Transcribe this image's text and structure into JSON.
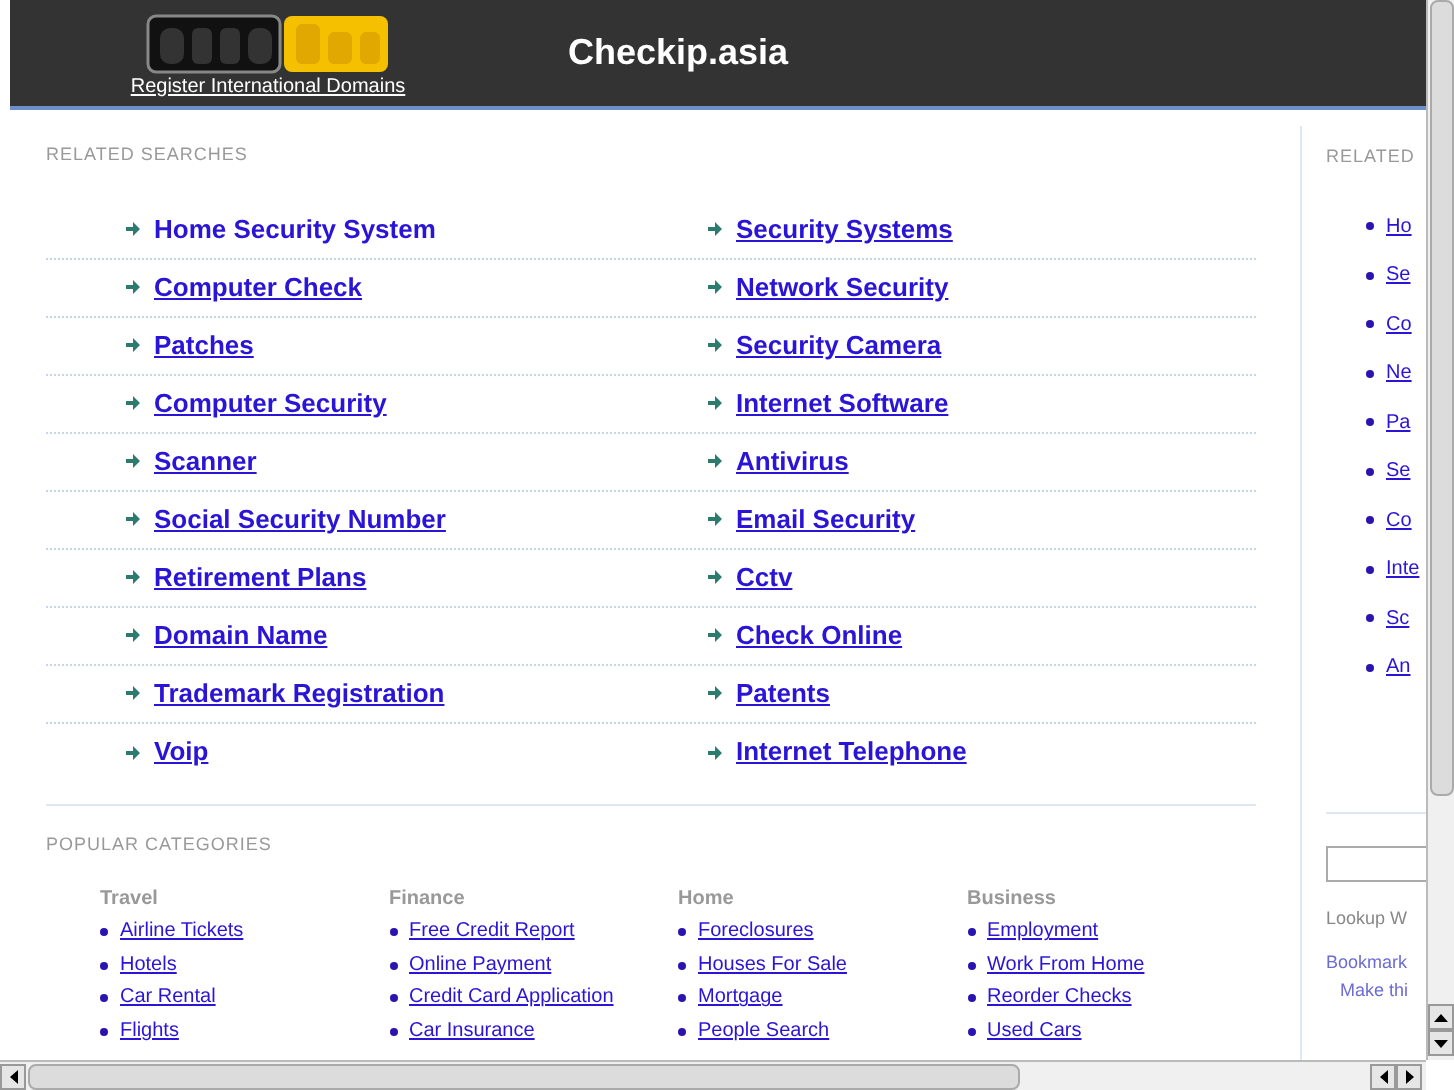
{
  "header": {
    "logo_tagline": "Register International Domains",
    "site_title": "Checkip.asia"
  },
  "related_searches": {
    "title": "RELATED SEARCHES",
    "left": [
      {
        "label": "Home Security System",
        "underlined": false
      },
      {
        "label": "Computer Check",
        "underlined": true
      },
      {
        "label": "Patches",
        "underlined": true
      },
      {
        "label": "Computer Security",
        "underlined": true
      },
      {
        "label": "Scanner",
        "underlined": true
      },
      {
        "label": "Social Security Number",
        "underlined": true
      },
      {
        "label": "Retirement Plans",
        "underlined": true
      },
      {
        "label": "Domain Name",
        "underlined": true
      },
      {
        "label": "Trademark Registration",
        "underlined": true
      },
      {
        "label": "Voip",
        "underlined": true
      }
    ],
    "right": [
      {
        "label": "Security Systems",
        "underlined": true
      },
      {
        "label": "Network Security",
        "underlined": true
      },
      {
        "label": "Security Camera",
        "underlined": true
      },
      {
        "label": "Internet Software",
        "underlined": true
      },
      {
        "label": "Antivirus",
        "underlined": true
      },
      {
        "label": "Email Security",
        "underlined": true
      },
      {
        "label": "Cctv",
        "underlined": true
      },
      {
        "label": "Check Online",
        "underlined": true
      },
      {
        "label": "Patents",
        "underlined": true
      },
      {
        "label": "Internet Telephone",
        "underlined": true
      }
    ]
  },
  "popular_categories": {
    "title": "POPULAR CATEGORIES",
    "columns": [
      {
        "heading": "Travel",
        "links": [
          "Airline Tickets",
          "Hotels",
          "Car Rental",
          "Flights"
        ]
      },
      {
        "heading": "Finance",
        "links": [
          "Free Credit Report",
          "Online Payment",
          "Credit Card Application",
          "Car Insurance"
        ]
      },
      {
        "heading": "Home",
        "links": [
          "Foreclosures",
          "Houses For Sale",
          "Mortgage",
          "People Search"
        ]
      },
      {
        "heading": "Business",
        "links": [
          "Employment",
          "Work From Home",
          "Reorder Checks",
          "Used Cars"
        ]
      }
    ]
  },
  "sidebar": {
    "title": "RELATED",
    "links": [
      "Ho",
      "Se",
      "Co",
      "Ne",
      "Pa",
      "Se",
      "Co",
      "Inte",
      "Sc",
      "An"
    ],
    "lookup_label": "Lookup W",
    "bookmark": "Bookmark",
    "make_home": "Make thi"
  }
}
